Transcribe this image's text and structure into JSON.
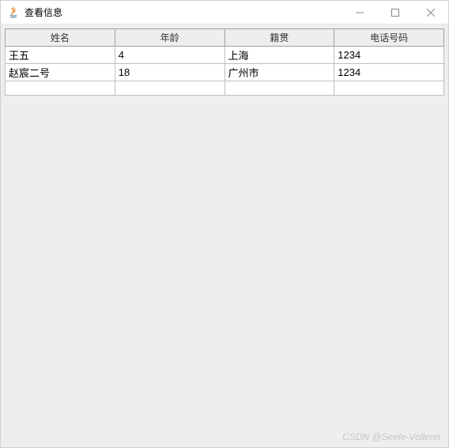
{
  "window": {
    "title": "查看信息"
  },
  "table": {
    "headers": [
      "姓名",
      "年龄",
      "籍贯",
      "电话号码"
    ],
    "rows": [
      [
        "王五",
        "4",
        "上海",
        "1234"
      ],
      [
        "赵宸二号",
        "18",
        "广州市",
        "1234"
      ],
      [
        "",
        "",
        "",
        ""
      ]
    ]
  },
  "watermark": "CSDN @Seele-Vollerei"
}
